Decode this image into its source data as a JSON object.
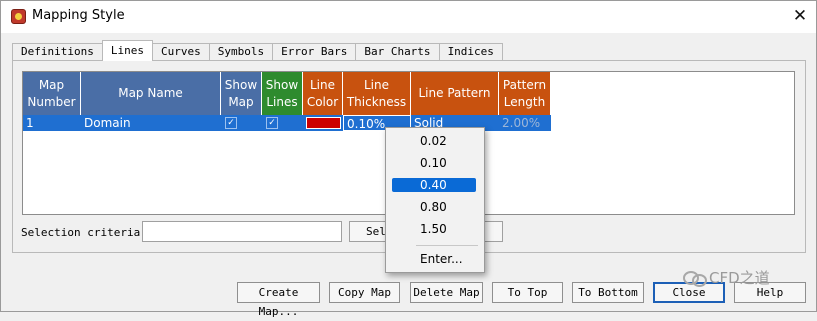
{
  "window": {
    "title": "Mapping Style",
    "close_glyph": "✕",
    "app_icon": "mapping-app-icon"
  },
  "tabs": [
    {
      "label": "Definitions",
      "active": false
    },
    {
      "label": "Lines",
      "active": true
    },
    {
      "label": "Curves",
      "active": false
    },
    {
      "label": "Symbols",
      "active": false
    },
    {
      "label": "Error Bars",
      "active": false
    },
    {
      "label": "Bar Charts",
      "active": false
    },
    {
      "label": "Indices",
      "active": false
    }
  ],
  "grid": {
    "headers": {
      "map_number": "Map Number",
      "map_name": "Map Name",
      "show_map": "Show Map",
      "show_lines": "Show Lines",
      "line_color": "Line Color",
      "line_thickness": "Line Thickness",
      "line_pattern": "Line Pattern",
      "pattern_length": "Pattern Length"
    },
    "row": {
      "map_number": "1",
      "map_name": "Domain",
      "show_map": "✓",
      "show_lines": "✓",
      "line_color": "#cc0000",
      "line_thickness": "0.10%",
      "line_pattern": "Solid",
      "pattern_length": "2.00%"
    }
  },
  "selection": {
    "label": "Selection criteria:",
    "value": "",
    "select_button": "Select"
  },
  "thickness_menu": {
    "items": [
      "0.02",
      "0.10",
      "0.40",
      "0.80",
      "1.50"
    ],
    "selected": "0.40",
    "enter_label": "Enter..."
  },
  "buttons": {
    "create_map": "Create Map...",
    "copy_map": "Copy Map",
    "delete_map": "Delete Map",
    "to_top": "To Top",
    "to_bottom": "To Bottom",
    "close": "Close",
    "help": "Help"
  },
  "watermark": {
    "text": "CFD之道",
    "icon": "wechat-logo-icon"
  },
  "colors": {
    "header_blue": "#4a6ea6",
    "header_green": "#2e8b2e",
    "header_orange": "#c8520f",
    "row_selected": "#1f6fd1",
    "menu_highlight": "#0a6ad6"
  }
}
